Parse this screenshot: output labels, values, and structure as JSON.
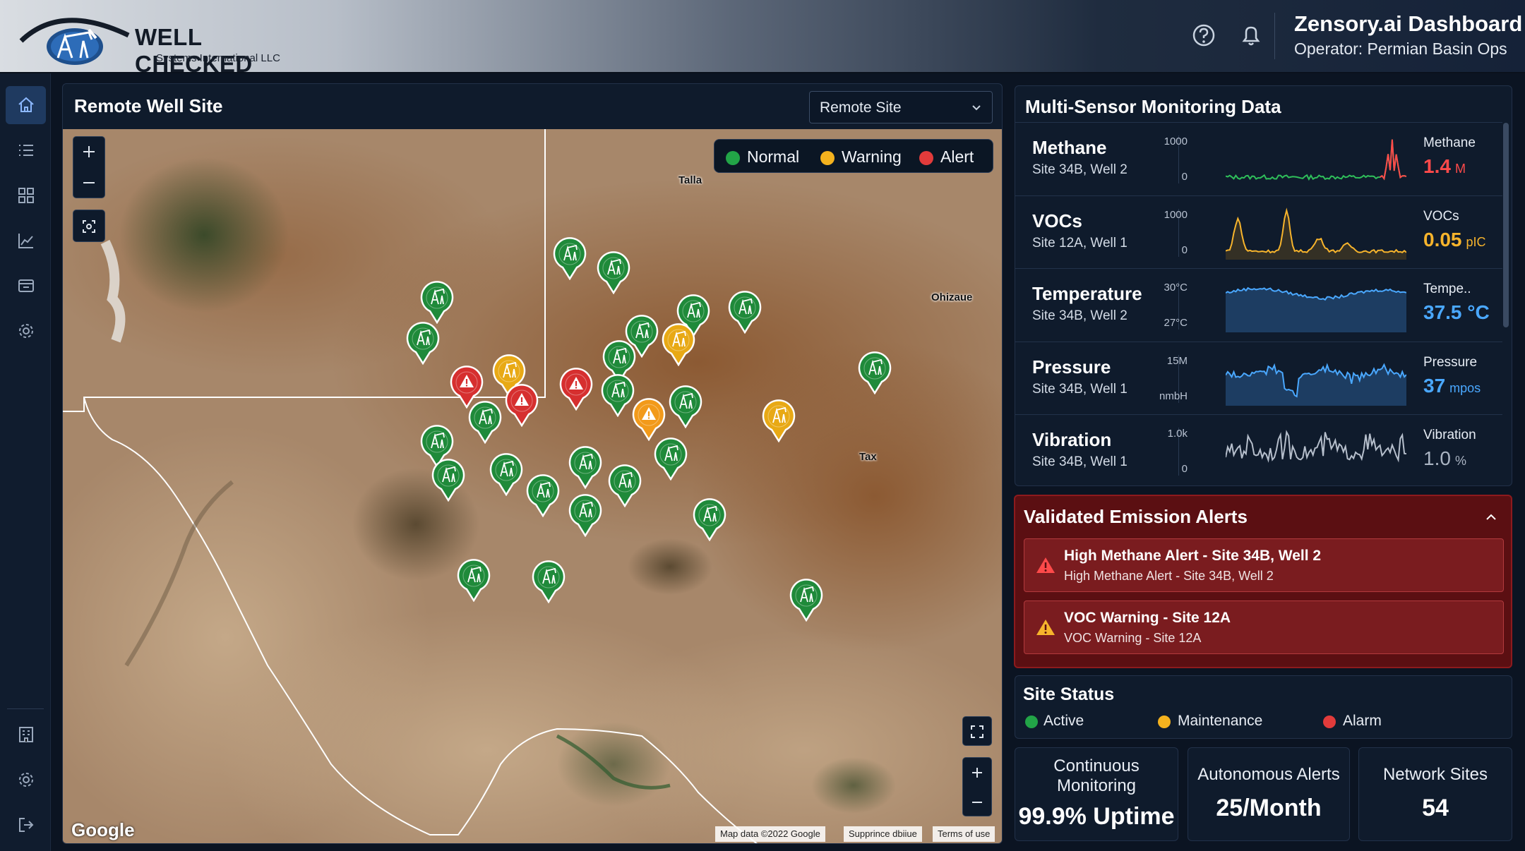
{
  "brand": {
    "name": "WELL CHECKED",
    "subtitle": "Systems International LLC"
  },
  "header": {
    "title": "Zensory.ai Dashboard",
    "subtitle": "Operator: Permian Basin Ops",
    "icons": [
      "help-icon",
      "bell-icon"
    ]
  },
  "sidebar": {
    "items": [
      "home-icon",
      "list-icon",
      "grid-icon",
      "chart-icon",
      "inbox-icon",
      "gear-icon"
    ],
    "bottom_items": [
      "building-icon",
      "gear-icon",
      "logout-icon"
    ],
    "active": "home-icon"
  },
  "map": {
    "title": "Remote Well Site",
    "select_value": "Remote Site",
    "legend": [
      {
        "label": "Normal",
        "color": "#22a447"
      },
      {
        "label": "Warning",
        "color": "#f4b21e"
      },
      {
        "label": "Alert",
        "color": "#e23b3b"
      }
    ],
    "places": [
      "Talla",
      "Ohizaue",
      "Tax"
    ],
    "google": "Google",
    "attributions": [
      "Map data ©2022 Google",
      "Supprince dbiiue",
      "Terms of use"
    ]
  },
  "sensors": {
    "title": "Multi-Sensor Monitoring Data",
    "rows": [
      {
        "name": "Methane",
        "site": "Site 34B, Well 2",
        "ymax": "1000",
        "ymin": "0",
        "label": "Methane",
        "value": "1.4",
        "unit": "M",
        "color": "#ff4a4a"
      },
      {
        "name": "VOCs",
        "site": "Site 12A, Well 1",
        "ymax": "1000",
        "ymin": "0",
        "label": "VOCs",
        "value": "0.05",
        "unit": "pIC",
        "color": "#f7b42c"
      },
      {
        "name": "Temperature",
        "site": "Site 34B, Well 2",
        "ymax": "30°C",
        "ymin": "27°C",
        "label": "Tempe..",
        "value": "37.5 °C",
        "unit": "",
        "color": "#4aa8ff"
      },
      {
        "name": "Pressure",
        "site": "Site 34B, Well 1",
        "ymax": "15M",
        "ymin": "nmbH",
        "label": "Pressure",
        "value": "37",
        "unit": "mpos",
        "color": "#4aa8ff"
      },
      {
        "name": "Vibration",
        "site": "Site 34B, Well 1",
        "ymax": "1.0k",
        "ymin": "0",
        "label": "Vibration",
        "value": "1.0",
        "unit": "%",
        "color": "#aab4c2"
      }
    ]
  },
  "alerts": {
    "title": "Validated Emission Alerts",
    "items": [
      {
        "title": "High Methane Alert - Site 34B, Well 2",
        "sub": "High Methane Alert - Site 34B, Well 2",
        "color": "#ff4a4a"
      },
      {
        "title": "VOC Warning - Site 12A",
        "sub": "VOC Warning - Site 12A",
        "color": "#f7b42c"
      }
    ]
  },
  "status": {
    "title": "Site Status",
    "items": [
      {
        "label": "Active",
        "color": "#22a447"
      },
      {
        "label": "Maintenance",
        "color": "#f4b21e"
      },
      {
        "label": "Alarm",
        "color": "#e23b3b"
      }
    ]
  },
  "kpis": [
    {
      "label": "Continuous Monitoring",
      "value": "99.9% Uptime"
    },
    {
      "label": "Autonomous Alerts",
      "value": "25/Month"
    },
    {
      "label": "Network Sites",
      "value": "54"
    }
  ]
}
